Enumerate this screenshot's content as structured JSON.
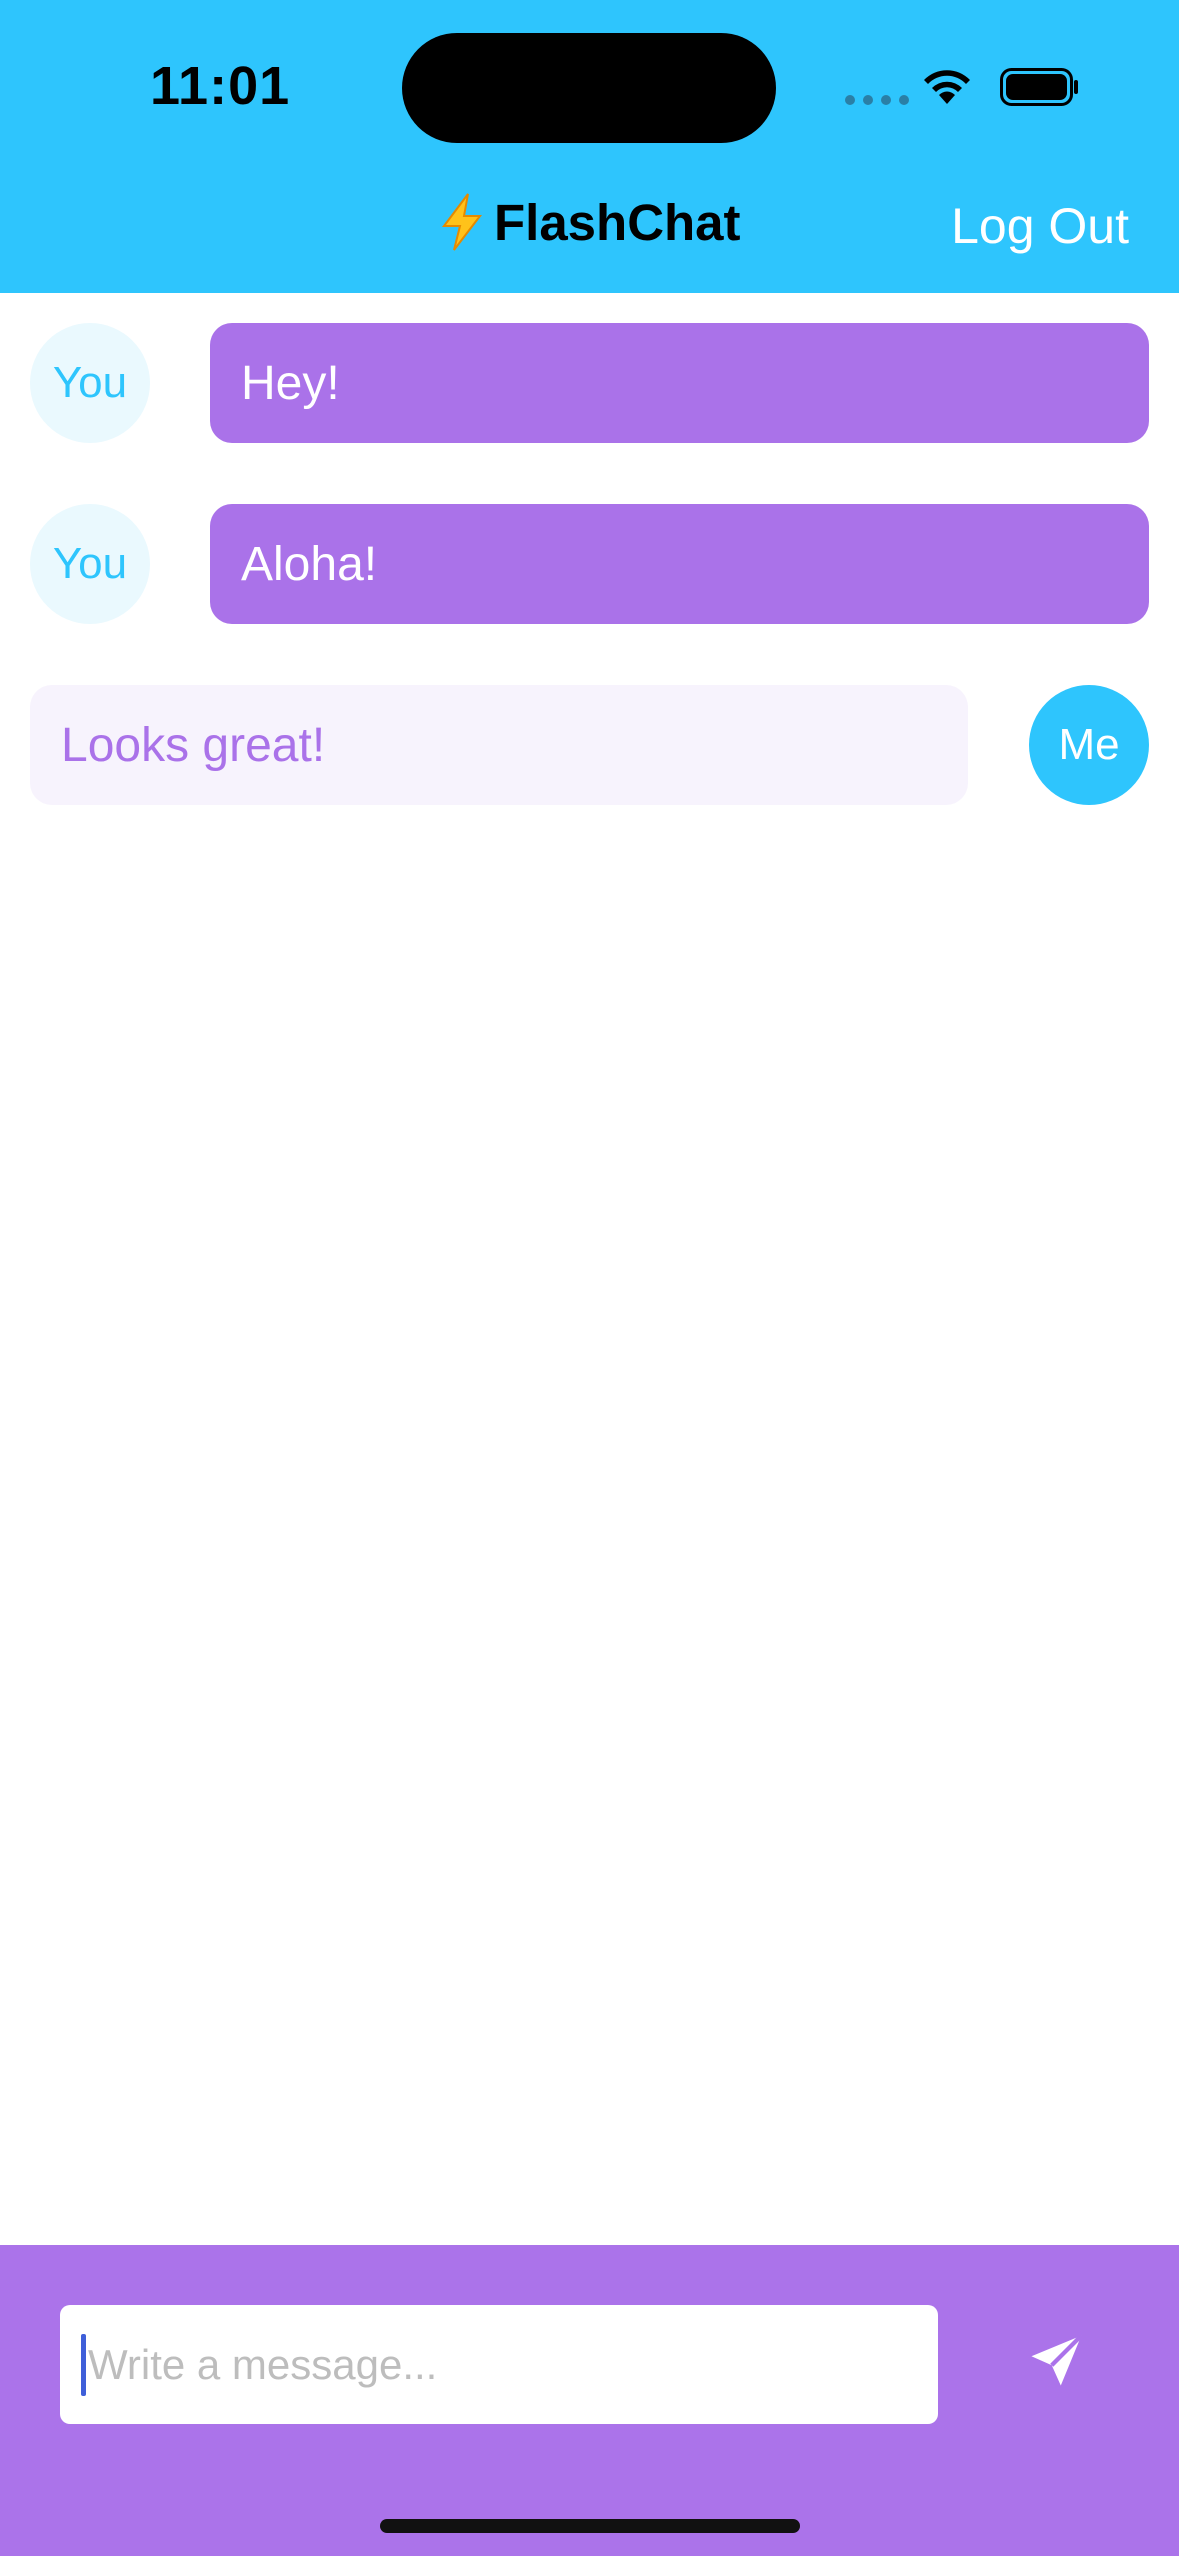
{
  "status_bar": {
    "time": "11:01"
  },
  "nav": {
    "title": "FlashChat",
    "logout_label": "Log Out"
  },
  "messages": [
    {
      "sender": "You",
      "text": "Hey!"
    },
    {
      "sender": "You",
      "text": "Aloha!"
    },
    {
      "sender": "Me",
      "text": "Looks great!"
    }
  ],
  "composer": {
    "placeholder": "Write a message...",
    "value": ""
  },
  "colors": {
    "header": "#2EC5FD",
    "accent_purple": "#AA72E9",
    "my_bubble": "#F7F3FD",
    "you_avatar": "#EAF9FE"
  },
  "icons": {
    "title_icon": "lightning-bolt-icon",
    "send_icon": "paper-plane-icon"
  }
}
